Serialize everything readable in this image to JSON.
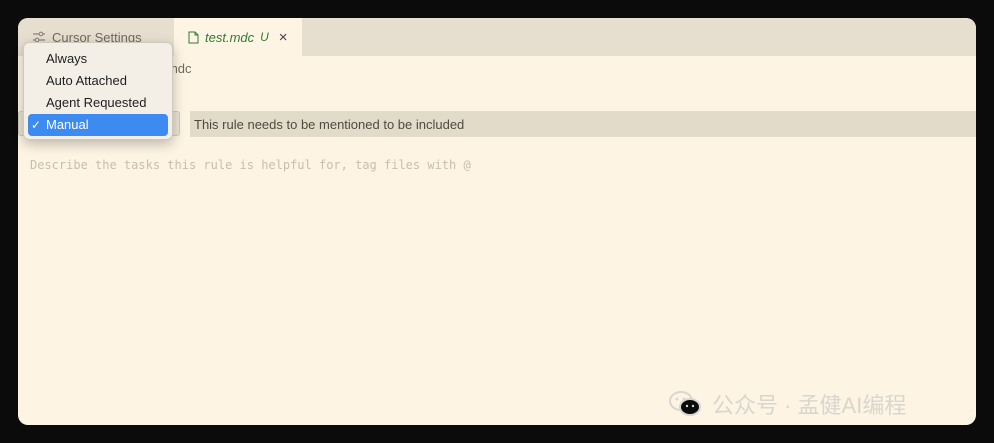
{
  "tabs": {
    "settings_label": "Cursor Settings",
    "file_label": "test.mdc",
    "file_status": "U"
  },
  "breadcrumb": {
    "text": "est.mdc"
  },
  "rule_type": {
    "options": [
      "Always",
      "Auto Attached",
      "Agent Requested",
      "Manual"
    ],
    "selected": "Manual",
    "description": "This rule needs to be mentioned to be included"
  },
  "editor": {
    "placeholder": "Describe the tasks this rule is helpful for, tag files with @"
  },
  "watermark": {
    "text": "公众号 · 孟健AI编程"
  },
  "colors": {
    "accent": "#3d8af0",
    "modified_tab_text": "#2f7d33",
    "editor_bg": "#fdf4e3"
  }
}
